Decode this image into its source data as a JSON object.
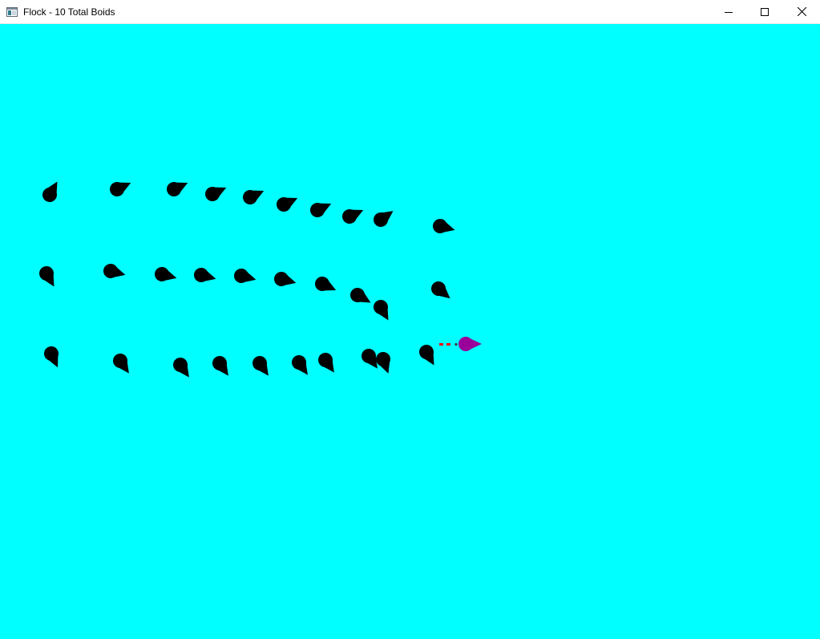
{
  "window": {
    "title": "Flock - 10 Total Boids",
    "icon": "app-window-icon",
    "controls": {
      "minimize_icon": "minimize-icon",
      "maximize_icon": "maximize-icon",
      "close_icon": "close-icon"
    }
  },
  "scene": {
    "background_color": "#00ffff",
    "boid_color": "#000000",
    "leader_color": "#990099",
    "leader_trail_color": "#ff0000",
    "total_boids": 10
  }
}
